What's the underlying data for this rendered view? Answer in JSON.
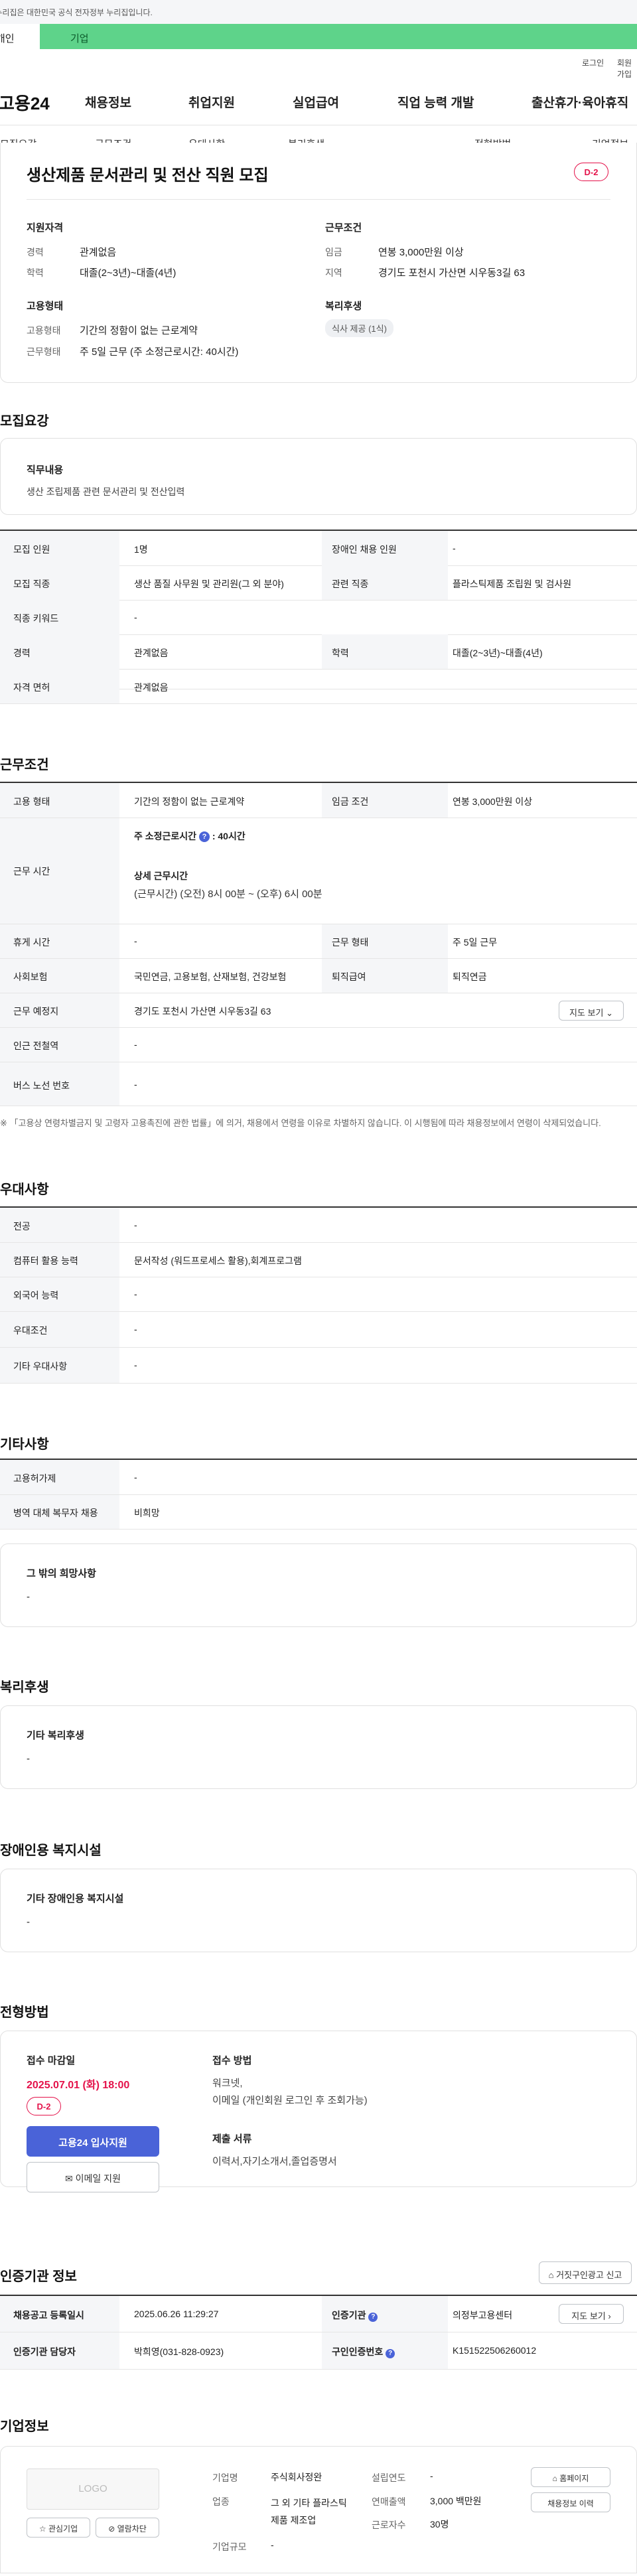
{
  "topbar": {
    "notice": "이 누리집은 대한민국 공식 전자정부 누리집입니다."
  },
  "tabs": [
    "개인",
    "기업"
  ],
  "util": {
    "login": "로그인",
    "join": "회원가입"
  },
  "logo": "고용24",
  "gnb": [
    "채용정보",
    "취업지원",
    "실업급여",
    "직업 능력 개발",
    "출산휴가·육아휴직"
  ],
  "snb": [
    "모집요강",
    "근무조건",
    "우대사항",
    "복리후생",
    "전형방법",
    "기업정보"
  ],
  "job": {
    "title": "생산제품 문서관리 및 전산 직원 모집",
    "dday": "D-2",
    "qual_title": "지원자격",
    "cond_title": "근무조건",
    "type_title": "고용형태",
    "welfare_title": "복리후생",
    "career_l": "경력",
    "career_v": "관계없음",
    "edu_l": "학력",
    "edu_v": "대졸(2~3년)~대졸(4년)",
    "wage_l": "임금",
    "wage_v": "연봉 3,000만원 이상",
    "region_l": "지역",
    "region_v": "경기도 포천시 가산면 시우동3길 63",
    "emptype_l": "고용형태",
    "emptype_v": "기간의 정함이 없는 근로계약",
    "worktype_l": "근무형태",
    "worktype_v": "주 5일 근무 (주 소정근로시간: 40시간)",
    "welfare_chip": "식사 제공 (1식)"
  },
  "recruit": {
    "heading": "모집요강",
    "duty_title": "직무내용",
    "duty_text": "생산 조립제품 관련 문서관리 및 전산입력",
    "rows": [
      {
        "l1": "모집 인원",
        "v1": "1명",
        "l2": "장애인 채용 인원",
        "v2": "-"
      },
      {
        "l1": "모집 직종",
        "v1": "생산 품질 사무원 및 관리원(그 외 분야)",
        "l2": "관련 직종",
        "v2": "플라스틱제품 조립원 및 검사원"
      },
      {
        "l1": "직종 키워드",
        "v1": "-"
      },
      {
        "l1": "경력",
        "v1": "관계없음",
        "l2": "학력",
        "v2": "대졸(2~3년)~대졸(4년)"
      },
      {
        "l1": "자격 면허",
        "v1": "관계없음"
      }
    ]
  },
  "work": {
    "heading": "근무조건",
    "emp_l": "고용 형태",
    "emp_v": "기간의 정함이 없는 근로계약",
    "wage_l": "임금 조건",
    "wage_v": "연봉 3,000만원 이상",
    "time_l": "근무 시간",
    "time_main": "주 소정근로시간",
    "time_hours": ": 40시간",
    "time_detail_t": "상세 근무시간",
    "time_detail_v": "(근무시간) (오전) 8시 00분 ~ (오후) 6시 00분",
    "rest_l": "휴게 시간",
    "rest_v": "-",
    "form_l": "근무 형태",
    "form_v": "주 5일 근무",
    "ins_l": "사회보험",
    "ins_v": "국민연금, 고용보험, 산재보험, 건강보험",
    "ret_l": "퇴직급여",
    "ret_v": "퇴직연금",
    "place_l": "근무 예정지",
    "place_v": "경기도 포천시 가산면 시우동3길 63",
    "map_btn": "지도 보기",
    "subway_l": "인근 전철역",
    "subway_v": "-",
    "bus_l": "버스 노선 번호",
    "bus_v": "-",
    "note": "※ 「고용상 연령차별금지 및 고령자 고용촉진에 관한 법률」에 의거, 채용에서 연령을 이유로 차별하지 않습니다. 이 시행됨에 따라 채용정보에서 연령이 삭제되었습니다."
  },
  "pref": {
    "heading": "우대사항",
    "rows": [
      {
        "l": "전공",
        "v": "-"
      },
      {
        "l": "컴퓨터 활용 능력",
        "v": "문서작성 (워드프로세스 활용),회계프로그램"
      },
      {
        "l": "외국어 능력",
        "v": "-"
      },
      {
        "l": "우대조건",
        "v": "-"
      },
      {
        "l": "기타 우대사항",
        "v": "-"
      }
    ]
  },
  "etc": {
    "heading": "기타사항",
    "rows": [
      {
        "l": "고용허가제",
        "v": "-"
      },
      {
        "l": "병역 대체 복무자 채용",
        "v": "비희망"
      }
    ],
    "other_t": "그 밖의 희망사항",
    "other_v": "-"
  },
  "welfare": {
    "heading": "복리후생",
    "box_t": "기타 복리후생",
    "box_v": "-"
  },
  "disab": {
    "heading": "장애인용 복지시설",
    "box_t": "기타 장애인용 복지시설",
    "box_v": "-"
  },
  "select": {
    "heading": "전형방법",
    "deadline_t": "접수 마감일",
    "deadline_v": "2025.07.01 (화) 18:00",
    "dday": "D-2",
    "apply_btn": "고용24 입사지원",
    "email_btn": "이메일 지원",
    "method_t": "접수 방법",
    "method_v1": "워크넷,",
    "method_v2": "이메일 (개인회원 로그인 후 조회가능)",
    "docs_t": "제출 서류",
    "docs_v": "이력서,자기소개서,졸업증명서"
  },
  "cert": {
    "heading": "인증기관 정보",
    "report_btn": "거짓구인광고 신고",
    "reg_l": "채용공고 등록일시",
    "reg_v": "2025.06.26 11:29:27",
    "org_l": "인증기관",
    "org_v": "의정부고용센터",
    "map_btn": "지도 보기",
    "mgr_l": "인증기관 담당자",
    "mgr_v": "박희영(031-828-0923)",
    "no_l": "구인인증번호",
    "no_v": "K151522506260012"
  },
  "company": {
    "heading": "기업정보",
    "logo_ph": "LOGO",
    "fav_btn": "관심기업",
    "block_btn": "열람차단",
    "name_l": "기업명",
    "name_v": "주식회사정완",
    "ind_l": "업종",
    "ind_v": "그 외 기타 플라스틱 제품 제조업",
    "size_l": "기업규모",
    "size_v": "-",
    "year_l": "설립연도",
    "year_v": "-",
    "sales_l": "연매출액",
    "sales_v": "3,000 백만원",
    "emp_l": "근로자수",
    "emp_v": "30명",
    "home_btn": "홈페이지",
    "history_btn": "채용정보 이력"
  },
  "colors": {
    "accent": "#4a63d8",
    "dday": "#e4124a",
    "green": "#5ed38a"
  }
}
